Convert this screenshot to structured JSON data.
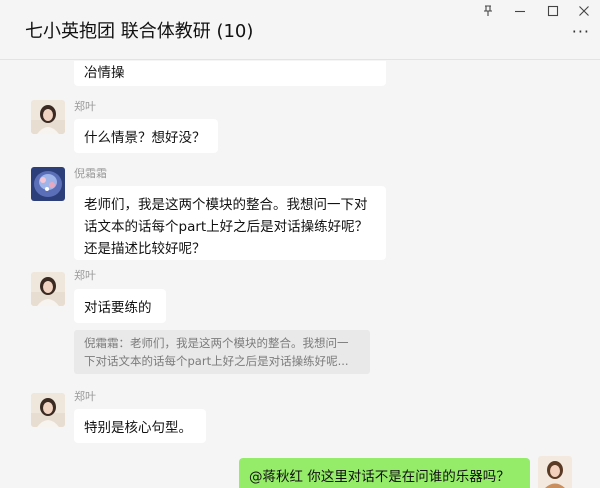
{
  "window": {
    "title": "七小英抱团 联合体教研 (10)",
    "pin_icon": "pin-icon",
    "minimize_icon": "minimize-icon",
    "maximize_icon": "maximize-icon",
    "close_icon": "close-icon",
    "more_label": "···"
  },
  "messages": [
    {
      "sender": "",
      "text_lines": [
        "冶情操"
      ],
      "side": "left"
    },
    {
      "sender": "郑叶",
      "text_lines": [
        "什么情景？想好没？"
      ],
      "side": "left"
    },
    {
      "sender": "倪霜霜",
      "text_lines": [
        "老师们，我是这两个模块的整合。我想问一下对",
        "话文本的话每个part上好之后是对话操练好呢？",
        "还是描述比较好呢？"
      ],
      "side": "left"
    },
    {
      "sender": "郑叶",
      "text_lines": [
        "对话要练的"
      ],
      "quote_lines": [
        "倪霜霜：老师们，我是这两个模块的整合。我想问一",
        "下对话文本的话每个part上好之后是对话操练好呢..."
      ],
      "side": "left"
    },
    {
      "sender": "郑叶",
      "text_lines": [
        "特别是核心句型。"
      ],
      "side": "left"
    },
    {
      "sender": "",
      "text_lines": [
        "@蒋秋红 你这里对话不是在问谁的乐器吗？"
      ],
      "side": "right"
    }
  ],
  "colors": {
    "bubble_self": "#95ec69",
    "bubble_other": "#ffffff",
    "background": "#f5f5f5"
  }
}
